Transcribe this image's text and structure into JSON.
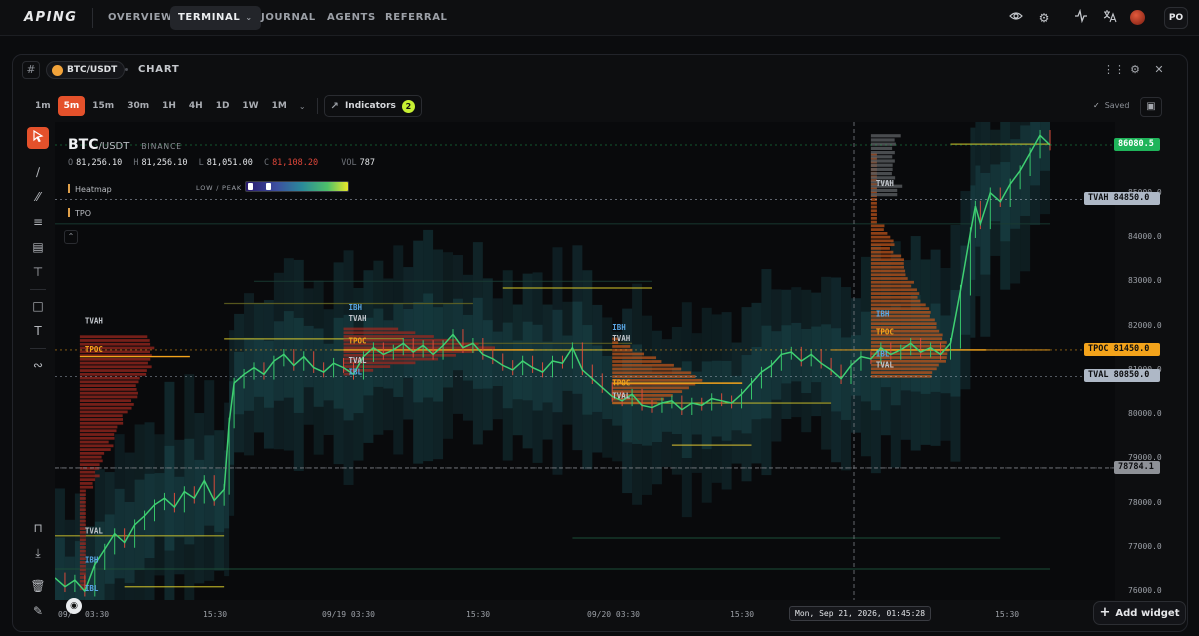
{
  "app": {
    "logo": "APING",
    "nav": [
      {
        "label": "OVERVIEW"
      },
      {
        "label": "TERMINAL",
        "active": true
      },
      {
        "label": "JOURNAL"
      },
      {
        "label": "AGENTS"
      },
      {
        "label": "REFERRAL"
      }
    ],
    "top_icons": [
      "eye-icon",
      "gear-icon",
      "activity-icon",
      "translate-icon",
      "avatar-icon"
    ],
    "user_initials": "PO"
  },
  "panel": {
    "symbol": "BTC/USDT",
    "title": "CHART",
    "timeframes": [
      {
        "label": "1m"
      },
      {
        "label": "5m",
        "active": true
      },
      {
        "label": "15m"
      },
      {
        "label": "30m"
      },
      {
        "label": "1H"
      },
      {
        "label": "4H"
      },
      {
        "label": "1D"
      },
      {
        "label": "1W"
      },
      {
        "label": "1M"
      }
    ],
    "indicators_label": "Indicators",
    "indicators_count": "2",
    "saved_label": "Saved",
    "add_widget_label": "Add widget"
  },
  "legend": {
    "symbol": "BTC",
    "quote": "/USDT",
    "exchange": "BINANCE",
    "open_key": "O",
    "open": "81,256.10",
    "high_key": "H",
    "high": "81,256.10",
    "low_key": "L",
    "low": "81,051.00",
    "close_key": "C",
    "close": "81,108.20",
    "vol_key": "VOL",
    "vol": "787",
    "heatmap_label": "Heatmap",
    "heatmap_scale": "LOW / PEAK",
    "tpo_label": "TPO"
  },
  "chart_data": {
    "type": "line",
    "y_ticks": [
      "85000.0",
      "84000.0",
      "83000.0",
      "82000.0",
      "81000.0",
      "80000.0",
      "79000.0",
      "78000.0",
      "77000.0",
      "76000.0"
    ],
    "ylim": [
      75800,
      86600
    ],
    "x_ticks": [
      "09/18 03:30",
      "15:30",
      "09/19 03:30",
      "15:30",
      "09/20 03:30",
      "15:30",
      "15:30"
    ],
    "x_tick_display": [
      "09/",
      "03:30",
      "15:30",
      "09/19 03:30",
      "15:30",
      "09/20 03:30",
      "15:30",
      "15:30"
    ],
    "price_tags": [
      {
        "label": "",
        "value": "86080.5",
        "price": 86080.5,
        "bg": "#1fb45a",
        "fg": "#ffffff"
      },
      {
        "label": "TVAH",
        "value": "84850.0",
        "price": 84850,
        "bg": "#aeb8c6",
        "fg": "#0d0e10"
      },
      {
        "label": "TPOC",
        "value": "81450.0",
        "price": 81450,
        "bg": "#f3a31b",
        "fg": "#0d0e10"
      },
      {
        "label": "TVAL",
        "value": "80850.0",
        "price": 80850,
        "bg": "#aeb8c6",
        "fg": "#0d0e10"
      },
      {
        "label": "",
        "value": "78784.1",
        "price": 78784.1,
        "bg": "#8e9197",
        "fg": "#0d0e10"
      }
    ],
    "crosshair_time": "Mon, Sep 21, 2026, 01:45:28",
    "crosshair_price": 78784.1,
    "price_path": [
      [
        0,
        76300
      ],
      [
        0.01,
        76100
      ],
      [
        0.02,
        76250
      ],
      [
        0.03,
        76000
      ],
      [
        0.04,
        76600
      ],
      [
        0.05,
        76950
      ],
      [
        0.06,
        77300
      ],
      [
        0.07,
        77100
      ],
      [
        0.08,
        77500
      ],
      [
        0.09,
        77700
      ],
      [
        0.1,
        77950
      ],
      [
        0.11,
        78100
      ],
      [
        0.12,
        77900
      ],
      [
        0.13,
        78250
      ],
      [
        0.14,
        78100
      ],
      [
        0.15,
        78500
      ],
      [
        0.16,
        78050
      ],
      [
        0.17,
        78300
      ],
      [
        0.175,
        79800
      ],
      [
        0.18,
        80700
      ],
      [
        0.19,
        80900
      ],
      [
        0.2,
        81050
      ],
      [
        0.21,
        80900
      ],
      [
        0.22,
        81200
      ],
      [
        0.23,
        81350
      ],
      [
        0.24,
        81100
      ],
      [
        0.25,
        81300
      ],
      [
        0.26,
        81050
      ],
      [
        0.27,
        80950
      ],
      [
        0.28,
        81150
      ],
      [
        0.29,
        81050
      ],
      [
        0.3,
        80900
      ],
      [
        0.31,
        81300
      ],
      [
        0.32,
        81500
      ],
      [
        0.33,
        81350
      ],
      [
        0.34,
        81450
      ],
      [
        0.35,
        81600
      ],
      [
        0.36,
        81400
      ],
      [
        0.37,
        81550
      ],
      [
        0.38,
        81350
      ],
      [
        0.39,
        81550
      ],
      [
        0.4,
        81800
      ],
      [
        0.41,
        81500
      ],
      [
        0.42,
        81600
      ],
      [
        0.43,
        81350
      ],
      [
        0.44,
        81250
      ],
      [
        0.45,
        81100
      ],
      [
        0.46,
        81000
      ],
      [
        0.47,
        81200
      ],
      [
        0.48,
        81050
      ],
      [
        0.49,
        80950
      ],
      [
        0.5,
        81200
      ],
      [
        0.51,
        81150
      ],
      [
        0.52,
        81500
      ],
      [
        0.53,
        81000
      ],
      [
        0.54,
        80800
      ],
      [
        0.55,
        80600
      ],
      [
        0.56,
        80400
      ],
      [
        0.57,
        80300
      ],
      [
        0.58,
        80450
      ],
      [
        0.59,
        80200
      ],
      [
        0.6,
        80150
      ],
      [
        0.61,
        80250
      ],
      [
        0.62,
        80300
      ],
      [
        0.63,
        80100
      ],
      [
        0.64,
        80250
      ],
      [
        0.65,
        80200
      ],
      [
        0.66,
        80350
      ],
      [
        0.67,
        80300
      ],
      [
        0.68,
        80250
      ],
      [
        0.69,
        80450
      ],
      [
        0.7,
        80700
      ],
      [
        0.71,
        80950
      ],
      [
        0.72,
        81100
      ],
      [
        0.73,
        81350
      ],
      [
        0.74,
        81400
      ],
      [
        0.75,
        81200
      ],
      [
        0.76,
        81350
      ],
      [
        0.77,
        81150
      ],
      [
        0.78,
        81000
      ],
      [
        0.79,
        80800
      ],
      [
        0.8,
        81100
      ],
      [
        0.81,
        81300
      ],
      [
        0.82,
        81250
      ],
      [
        0.83,
        81500
      ],
      [
        0.84,
        81350
      ],
      [
        0.85,
        81450
      ],
      [
        0.86,
        81600
      ],
      [
        0.87,
        81400
      ],
      [
        0.88,
        81500
      ],
      [
        0.89,
        81350
      ],
      [
        0.9,
        81600
      ],
      [
        0.91,
        82800
      ],
      [
        0.92,
        84100
      ],
      [
        0.925,
        84700
      ],
      [
        0.93,
        84300
      ],
      [
        0.94,
        85000
      ],
      [
        0.95,
        84800
      ],
      [
        0.96,
        85200
      ],
      [
        0.97,
        85500
      ],
      [
        0.98,
        85900
      ],
      [
        0.99,
        86300
      ],
      [
        1,
        86080
      ]
    ]
  }
}
